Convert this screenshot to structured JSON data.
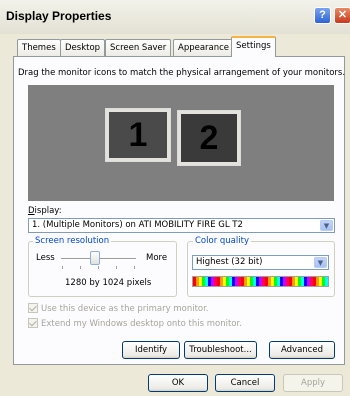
{
  "window": {
    "title": "Display Properties",
    "help_glyph": "?",
    "close_glyph": "✕"
  },
  "tabs": [
    {
      "label": "Themes",
      "active": false
    },
    {
      "label": "Desktop",
      "active": false
    },
    {
      "label": "Screen Saver",
      "active": false
    },
    {
      "label": "Appearance",
      "active": false
    },
    {
      "label": "Settings",
      "active": true
    }
  ],
  "settings": {
    "instruction": "Drag the monitor icons to match the physical arrangement of your monitors.",
    "monitors": [
      {
        "number": "1"
      },
      {
        "number": "2"
      }
    ],
    "display_label": "Display:",
    "display_value": "1. (Multiple Monitors) on ATI MOBILITY FIRE GL T2",
    "screen_resolution": {
      "legend": "Screen resolution",
      "less_label": "Less",
      "more_label": "More",
      "value": "1280 by 1024 pixels",
      "slider_fraction": 0.45
    },
    "color_quality": {
      "legend": "Color quality",
      "value": "Highest (32 bit)"
    },
    "checkboxes": {
      "primary": {
        "label": "Use this device as the primary monitor.",
        "checked": true,
        "enabled": false
      },
      "extend": {
        "label": "Extend my Windows desktop onto this monitor.",
        "checked": true,
        "enabled": false
      }
    },
    "buttons": {
      "identify": "Identify",
      "troubleshoot": "Troubleshoot...",
      "advanced": "Advanced"
    }
  },
  "dialog_buttons": {
    "ok": "OK",
    "cancel": "Cancel",
    "apply": "Apply"
  },
  "icons": {
    "dropdown_arrow": "chevron-down-icon",
    "help": "help-icon",
    "close": "close-icon"
  },
  "colors": {
    "xp_blue_legend": "#0046d5",
    "tab_highlight": "#f6b444",
    "button_border": "#003c74"
  }
}
